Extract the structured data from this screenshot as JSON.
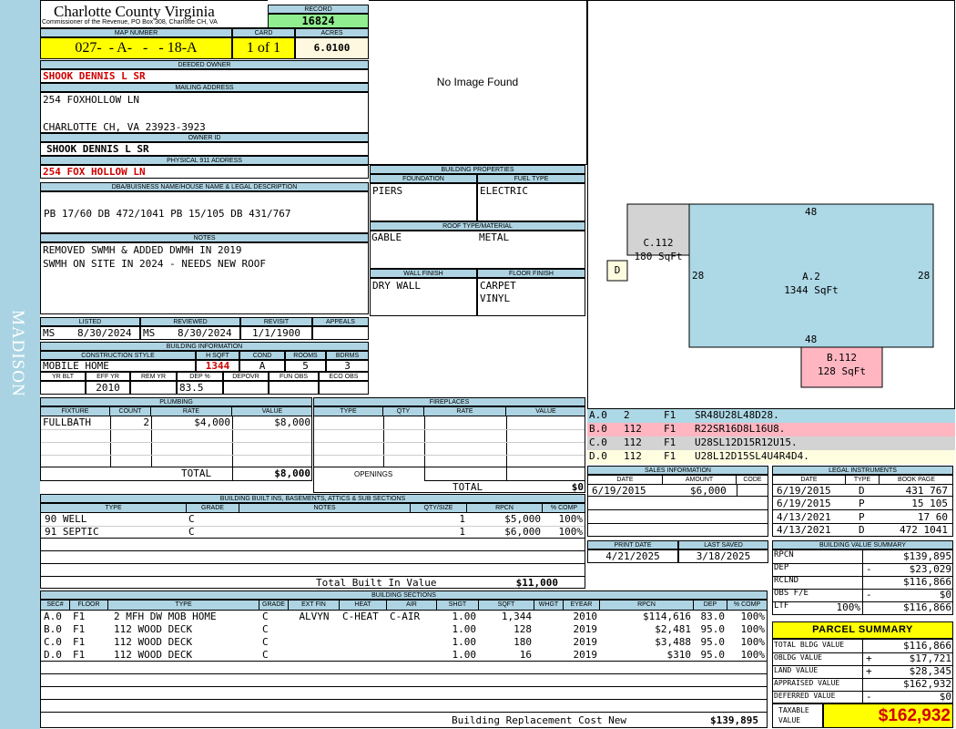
{
  "sidebar": {
    "district": "MADISON"
  },
  "header": {
    "county": "Charlotte County Virginia",
    "address_line": "Commissioner of the Revenue, PO Box 308, Charlotte CH, VA",
    "record_label": "RECORD",
    "record": "16824",
    "map_number_label": "MAP NUMBER",
    "map_number": "027-  - A-   -   - 18-A",
    "card_label": "CARD",
    "card": "1 of 1",
    "acres_label": "ACRES",
    "acres": "6.0100"
  },
  "owner": {
    "deeded_owner_label": "DEEDED OWNER",
    "deeded_owner": "SHOOK DENNIS L SR",
    "mailing_label": "MAILING ADDRESS",
    "mailing_line1": "254 FOXHOLLOW LN",
    "mailing_line2": "CHARLOTTE CH, VA 23923-3923",
    "owner_id_label": "OWNER ID",
    "owner_id": "SHOOK DENNIS L SR",
    "physical_label": "PHYSICAL 911 ADDRESS",
    "physical": "254 FOX HOLLOW LN",
    "dba_label": "DBA/BUISNESS NAME/HOUSE NAME & LEGAL DESCRIPTION",
    "legal": "PB 17/60 DB 472/1041 PB 15/105 DB 431/767",
    "notes_label": "NOTES",
    "notes_line1": "REMOVED SWMH & ADDED DWMH IN 2019",
    "notes_line2": "SWMH ON SITE IN 2024 - NEEDS NEW ROOF"
  },
  "image": {
    "no_image": "No Image Found"
  },
  "building_properties": {
    "title": "BUILDING PROPERTIES",
    "foundation_label": "FOUNDATION",
    "foundation": "PIERS",
    "fuel_label": "FUEL TYPE",
    "fuel": "ELECTRIC",
    "roof_label": "ROOF TYPE/MATERIAL",
    "roof_type": "GABLE",
    "roof_material": "METAL",
    "wall_label": "WALL FINISH",
    "wall": "DRY WALL",
    "floor_label": "FLOOR FINISH",
    "floor1": "CARPET",
    "floor2": "VINYL"
  },
  "review": {
    "listed_label": "LISTED",
    "listed_by": "MS",
    "listed": "8/30/2024",
    "reviewed_label": "REVIEWED",
    "reviewed_by": "MS",
    "reviewed": "8/30/2024",
    "revisit_label": "REVISIT",
    "revisit": "1/1/1900",
    "appeals_label": "APPEALS",
    "appeals": ""
  },
  "building_info": {
    "title": "BUILDING INFORMATION",
    "style_label": "CONSTRUCTION STYLE",
    "style": "MOBILE HOME",
    "hsqft_label": "H SQFT",
    "hsqft": "1344",
    "cond_label": "COND",
    "cond": "A",
    "rooms_label": "ROOMS",
    "rooms": "5",
    "bdrms_label": "BDRMS",
    "bdrms": "3",
    "yrblt_label": "YR BLT",
    "yrblt": "",
    "effyr_label": "EFF YR",
    "effyr": "2010",
    "remyr_label": "REM YR",
    "remyr": "",
    "dep_label": "DEP %",
    "dep": "83.5",
    "depovr_label": "DEPOVR",
    "depovr": "",
    "funobs_label": "FUN OBS",
    "funobs": "",
    "ecoobs_label": "ECO OBS",
    "ecoobs": ""
  },
  "plumbing": {
    "title": "PLUMBING",
    "headers": [
      "FIXTURE",
      "COUNT",
      "RATE",
      "VALUE"
    ],
    "rows": [
      [
        "FULLBATH",
        "2",
        "$4,000",
        "$8,000"
      ]
    ],
    "total_label": "TOTAL",
    "total": "$8,000"
  },
  "fireplaces": {
    "title": "FIREPLACES",
    "headers": [
      "TYPE",
      "QTY",
      "RATE",
      "VALUE"
    ],
    "openings_label": "OPENINGS",
    "total_label": "TOTAL",
    "total": "$0"
  },
  "built_ins": {
    "title": "BUILDING BUILT INS, BASEMENTS, ATTICS & SUB SECTIONS",
    "headers": [
      "TYPE",
      "GRADE",
      "NOTES",
      "QTY/SIZE",
      "RPCN",
      "% COMP"
    ],
    "rows": [
      [
        "90 WELL",
        "C",
        "",
        "1",
        "$5,000",
        "100%"
      ],
      [
        "91 SEPTIC",
        "C",
        "",
        "1",
        "$6,000",
        "100%"
      ]
    ],
    "total_label": "Total Built In Value",
    "total": "$11,000"
  },
  "sketch": {
    "sections": [
      {
        "code": "C.112",
        "sqft": "180 SqFt"
      },
      {
        "code": "A.2",
        "sqft": "1344 SqFt"
      },
      {
        "code": "B.112",
        "sqft": "128 SqFt"
      },
      {
        "code": "D",
        "sqft": ""
      }
    ],
    "dims": {
      "top": "48",
      "bottom": "48",
      "left": "28",
      "right": "28"
    },
    "legend": [
      {
        "code": "A.0",
        "num": "2",
        "floor": "F1",
        "path": "SR48U28L48D28."
      },
      {
        "code": "B.0",
        "num": "112",
        "floor": "F1",
        "path": "R22SR16D8L16U8."
      },
      {
        "code": "C.0",
        "num": "112",
        "floor": "F1",
        "path": "U28SL12D15R12U15."
      },
      {
        "code": "D.0",
        "num": "112",
        "floor": "F1",
        "path": "U28L12D15SL4U4R4D4."
      }
    ]
  },
  "sales": {
    "title": "SALES INFORMATION",
    "headers": [
      "DATE",
      "AMOUNT",
      "CODE"
    ],
    "rows": [
      [
        "6/19/2015",
        "$6,000",
        ""
      ]
    ]
  },
  "legal_instruments": {
    "title": "LEGAL INSTRUMENTS",
    "headers": [
      "DATE",
      "TYPE",
      "BOOK PAGE"
    ],
    "rows": [
      [
        "6/19/2015",
        "D",
        "431 767"
      ],
      [
        "6/19/2015",
        "P",
        "15 105"
      ],
      [
        "4/13/2021",
        "P",
        "17 60"
      ],
      [
        "4/13/2021",
        "D",
        "472 1041"
      ]
    ]
  },
  "dates": {
    "print_label": "PRINT DATE",
    "print": "4/21/2025",
    "saved_label": "LAST SAVED",
    "saved": "3/18/2025"
  },
  "bv_summary": {
    "title": "BUILDING VALUE SUMMARY",
    "rows": [
      {
        "label": "RPCN",
        "sign": "",
        "value": "$139,895"
      },
      {
        "label": "DEP",
        "sign": "-",
        "value": "$23,029"
      },
      {
        "label": "RCLND",
        "sign": "",
        "value": "$116,866"
      },
      {
        "label": "OBS F/E",
        "sign": "-",
        "value": "$0"
      },
      {
        "label": "LTF",
        "pct": "100%",
        "sign": "",
        "value": "$116,866"
      }
    ]
  },
  "parcel_summary": {
    "title": "PARCEL SUMMARY",
    "rows": [
      {
        "label": "TOTAL BLDG VALUE",
        "sign": "",
        "value": "$116,866"
      },
      {
        "label": "OBLDG VALUE",
        "sign": "+",
        "value": "$17,721"
      },
      {
        "label": "LAND VALUE",
        "sign": "+",
        "value": "$28,345"
      },
      {
        "label": "APPRAISED VALUE",
        "sign": "",
        "value": "$162,932"
      },
      {
        "label": "DEFERRED VALUE",
        "sign": "-",
        "value": "$0"
      }
    ],
    "taxable_label1": "TAXABLE",
    "taxable_label2": "VALUE",
    "taxable": "$162,932"
  },
  "sections": {
    "title": "BUILDING SECTIONS",
    "headers": [
      "SEC#",
      "FLOOR",
      "TYPE",
      "GRADE",
      "EXT FIN",
      "HEAT",
      "AIR",
      "SHGT",
      "SQFT",
      "WHGT",
      "EYEAR",
      "RPCN",
      "DEP",
      "% COMP"
    ],
    "rows": [
      [
        "A.0",
        "F1",
        "2 MFH DW MOB HOME",
        "C",
        "ALVYN",
        "C-HEAT",
        "C-AIR",
        "1.00",
        "1,344",
        "",
        "2010",
        "$114,616",
        "83.0",
        "100%"
      ],
      [
        "B.0",
        "F1",
        "112 WOOD DECK",
        "C",
        "",
        "",
        "",
        "1.00",
        "128",
        "",
        "2019",
        "$2,481",
        "95.0",
        "100%"
      ],
      [
        "C.0",
        "F1",
        "112 WOOD DECK",
        "C",
        "",
        "",
        "",
        "1.00",
        "180",
        "",
        "2019",
        "$3,488",
        "95.0",
        "100%"
      ],
      [
        "D.0",
        "F1",
        "112 WOOD DECK",
        "C",
        "",
        "",
        "",
        "1.00",
        "16",
        "",
        "2019",
        "$310",
        "95.0",
        "100%"
      ]
    ],
    "total_label": "Building Replacement Cost New",
    "total": "$139,895"
  }
}
